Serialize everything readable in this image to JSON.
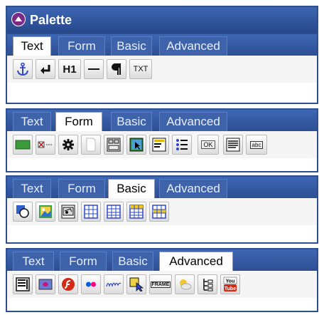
{
  "palette": {
    "title": "Palette"
  },
  "panels": [
    {
      "tabs": [
        "Text",
        "Form",
        "Basic",
        "Advanced"
      ],
      "active": "Text",
      "icons": [
        "anchor-icon",
        "line-break-icon",
        "heading-h1-icon",
        "horizontal-rule-icon",
        "paragraph-icon",
        "plain-text-icon"
      ],
      "icon_text": {
        "heading": "H1",
        "plain_text": "TXT"
      }
    },
    {
      "tabs": [
        "Text",
        "Form",
        "Basic",
        "Advanced"
      ],
      "active": "Form",
      "icons": [
        "submit-button-icon",
        "checkbox-field-icon",
        "gear-icon",
        "blank-document-icon",
        "form-layout-icon",
        "image-button-icon",
        "textarea-icon",
        "list-icon",
        "ok-button-icon",
        "text-block-icon",
        "text-input-icon"
      ],
      "icon_text": {
        "ok": "OK",
        "input": "abc"
      }
    },
    {
      "tabs": [
        "Text",
        "Form",
        "Basic",
        "Advanced"
      ],
      "active": "Basic",
      "icons": [
        "shape-icon",
        "image-icon",
        "media-icon",
        "table-icon",
        "grid-table-icon",
        "yellow-table-icon",
        "header-table-icon"
      ]
    },
    {
      "tabs": [
        "Text",
        "Form",
        "Basic",
        "Advanced"
      ],
      "active": "Advanced",
      "icons": [
        "widget-panel-icon",
        "slideshow-icon",
        "flash-icon",
        "flickr-icon",
        "scribble-icon",
        "cursor-select-icon",
        "iframe-icon",
        "weather-icon",
        "tree-icon",
        "youtube-icon"
      ],
      "icon_text": {
        "iframe": "FRAME",
        "youtube": "You Tube"
      }
    }
  ],
  "colors": {
    "header_blue": "#2e4f8f",
    "tab_blue": "#3f63aa"
  }
}
